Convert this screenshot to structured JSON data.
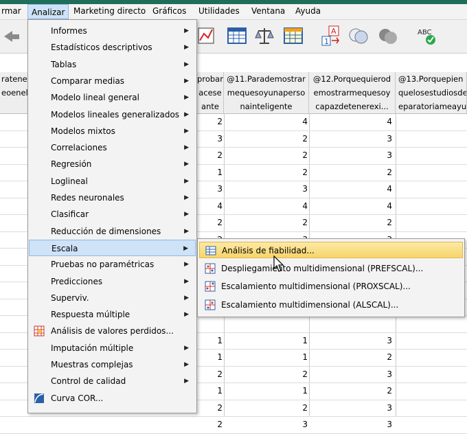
{
  "menubar": {
    "items": [
      {
        "label": "rmar"
      },
      {
        "label": "Analizar"
      },
      {
        "label": "Marketing directo"
      },
      {
        "label": "Gráficos"
      },
      {
        "label": "Utilidades"
      },
      {
        "label": "Ventana"
      },
      {
        "label": "Ayuda"
      }
    ]
  },
  "columns": [
    {
      "line1": "ratener",
      "line2": "eoenel",
      "line3": ""
    },
    {
      "line1": "probar",
      "line2": "acese",
      "line3": "ante"
    },
    {
      "line1": "@11.Parademostrar",
      "line2": "mequesoyunaperso",
      "line3": "nainteligente"
    },
    {
      "line1": "@12.Porquequierod",
      "line2": "emostrarmequesoy",
      "line3": "capazdetenerexi..."
    },
    {
      "line1": "@13.Porquepien",
      "line2": "quelosestudiosde",
      "line3": "eparatoriameayu"
    }
  ],
  "rows": [
    [
      "2",
      "4",
      "4"
    ],
    [
      "3",
      "2",
      "3"
    ],
    [
      "2",
      "2",
      "3"
    ],
    [
      "1",
      "2",
      "2"
    ],
    [
      "3",
      "3",
      "4"
    ],
    [
      "4",
      "4",
      "4"
    ],
    [
      "2",
      "2",
      "2"
    ],
    [
      "2",
      "3",
      "3"
    ],
    [
      "",
      "",
      ""
    ],
    [
      "",
      "",
      ""
    ],
    [
      "",
      "",
      ""
    ],
    [
      "",
      "",
      ""
    ],
    [
      "",
      "",
      ""
    ],
    [
      "1",
      "1",
      "3"
    ],
    [
      "1",
      "1",
      "2"
    ],
    [
      "2",
      "2",
      "3"
    ],
    [
      "1",
      "1",
      "2"
    ],
    [
      "2",
      "2",
      "3"
    ],
    [
      "2",
      "3",
      "3"
    ]
  ],
  "analyze_menu": [
    {
      "label": "Informes",
      "arrow": "▶"
    },
    {
      "label": "Estadísticos descriptivos",
      "arrow": "▶"
    },
    {
      "label": "Tablas",
      "arrow": "▶"
    },
    {
      "label": "Comparar medias",
      "arrow": "▶"
    },
    {
      "label": "Modelo lineal general",
      "arrow": "▶"
    },
    {
      "label": "Modelos lineales generalizados",
      "arrow": "▶"
    },
    {
      "label": "Modelos mixtos",
      "arrow": "▶"
    },
    {
      "label": "Correlaciones",
      "arrow": "▶"
    },
    {
      "label": "Regresión",
      "arrow": "▶"
    },
    {
      "label": "Loglineal",
      "arrow": "▶"
    },
    {
      "label": "Redes neuronales",
      "arrow": "▶"
    },
    {
      "label": "Clasificar",
      "arrow": "▶"
    },
    {
      "label": "Reducción de dimensiones",
      "arrow": "▶"
    },
    {
      "label": "Escala",
      "arrow": "▶"
    },
    {
      "label": "Pruebas no paramétricas",
      "arrow": "▶"
    },
    {
      "label": "Predicciones",
      "arrow": "▶"
    },
    {
      "label": "Superviv.",
      "arrow": "▶"
    },
    {
      "label": "Respuesta múltiple",
      "arrow": "▶"
    },
    {
      "label": "Análisis de valores perdidos...",
      "arrow": ""
    },
    {
      "label": "Imputación múltiple",
      "arrow": "▶"
    },
    {
      "label": "Muestras complejas",
      "arrow": "▶"
    },
    {
      "label": "Control de calidad",
      "arrow": "▶"
    },
    {
      "label": "Curva COR...",
      "arrow": ""
    }
  ],
  "scale_submenu": [
    {
      "label": "Análisis de fiabilidad..."
    },
    {
      "label": "Despliegamiento multidimensional (PREFSCAL)..."
    },
    {
      "label": "Escalamiento multidimensional (PROXSCAL)..."
    },
    {
      "label": "Escalamiento multidimensional (ALSCAL)..."
    }
  ],
  "toolbar": {
    "icons": [
      "back-arrow-icon",
      "chart-icon",
      "table-grid-icon",
      "balance-scale-icon",
      "grid-select-icon",
      "value-labels-icon",
      "circles-icon",
      "sets-icon",
      "spell-check-icon"
    ],
    "spell_label": "ABC"
  },
  "colors": {
    "highlight": "#cfe3f7",
    "submenu_highlight": "#f7d56b",
    "title_bar": "#1e6e5a"
  }
}
